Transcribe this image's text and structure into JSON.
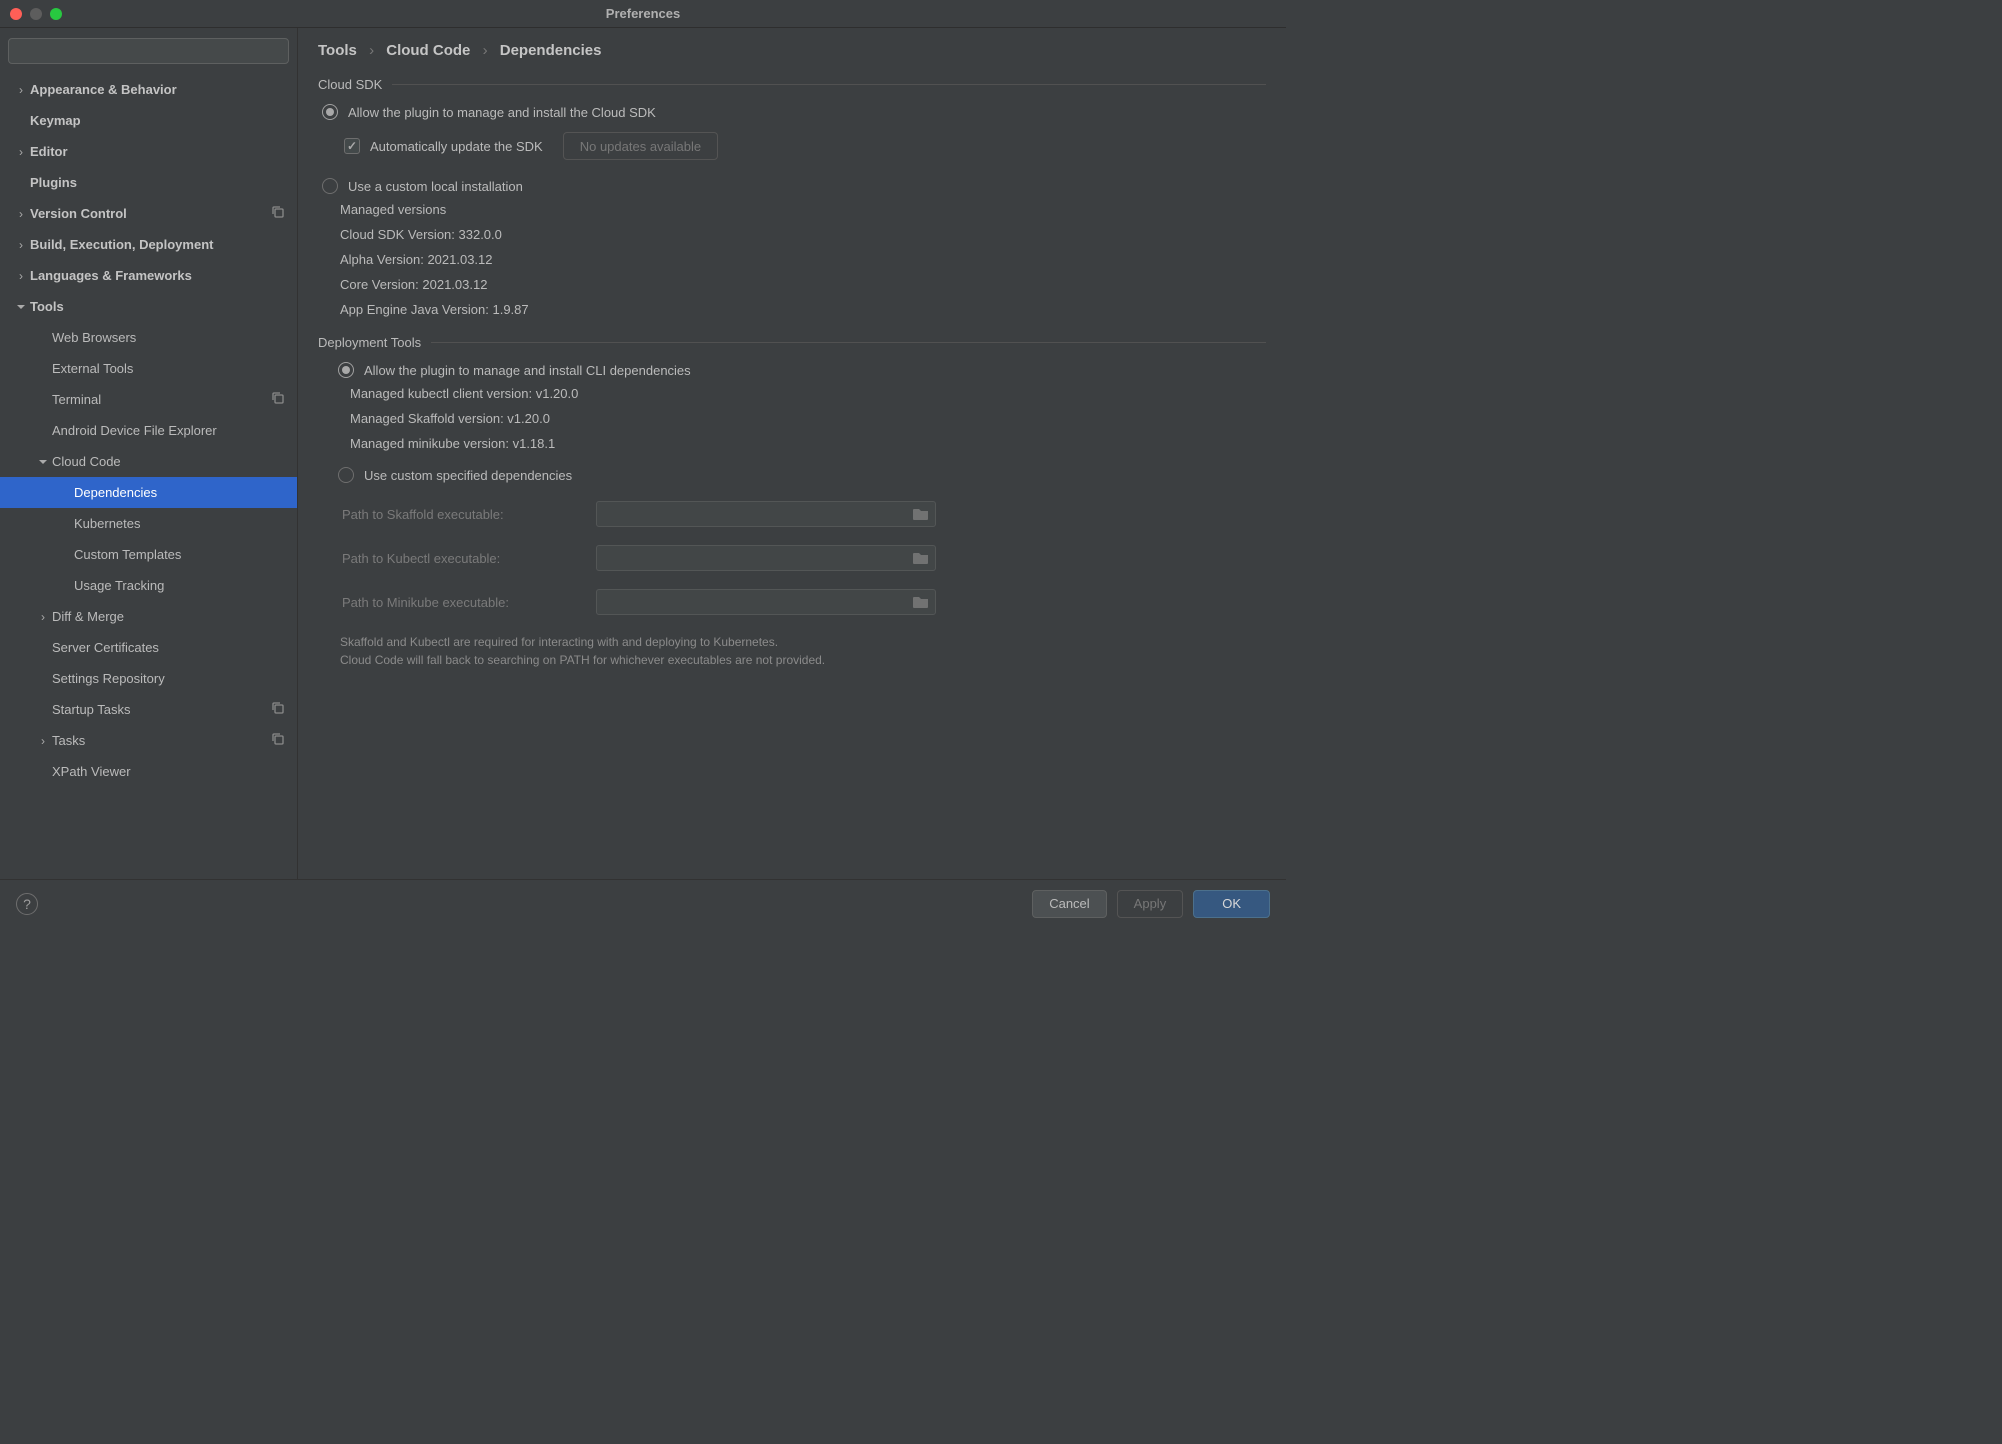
{
  "window": {
    "title": "Preferences"
  },
  "sidebar": {
    "search_placeholder": "",
    "items": [
      {
        "label": "Appearance & Behavior",
        "bold": true,
        "arrow": "right",
        "indent": 1
      },
      {
        "label": "Keymap",
        "bold": true,
        "arrow": "",
        "indent": 1
      },
      {
        "label": "Editor",
        "bold": true,
        "arrow": "right",
        "indent": 1
      },
      {
        "label": "Plugins",
        "bold": true,
        "arrow": "",
        "indent": 1
      },
      {
        "label": "Version Control",
        "bold": true,
        "arrow": "right",
        "indent": 1,
        "copy": true
      },
      {
        "label": "Build, Execution, Deployment",
        "bold": true,
        "arrow": "right",
        "indent": 1
      },
      {
        "label": "Languages & Frameworks",
        "bold": true,
        "arrow": "right",
        "indent": 1
      },
      {
        "label": "Tools",
        "bold": true,
        "arrow": "down",
        "indent": 1
      },
      {
        "label": "Web Browsers",
        "indent": 2,
        "arrow": ""
      },
      {
        "label": "External Tools",
        "indent": 2,
        "arrow": ""
      },
      {
        "label": "Terminal",
        "indent": 2,
        "arrow": "",
        "copy": true
      },
      {
        "label": "Android Device File Explorer",
        "indent": 2,
        "arrow": ""
      },
      {
        "label": "Cloud Code",
        "indent": 2,
        "arrow": "down"
      },
      {
        "label": "Dependencies",
        "indent": 3,
        "arrow": "",
        "selected": true
      },
      {
        "label": "Kubernetes",
        "indent": 3,
        "arrow": ""
      },
      {
        "label": "Custom Templates",
        "indent": 3,
        "arrow": ""
      },
      {
        "label": "Usage Tracking",
        "indent": 3,
        "arrow": ""
      },
      {
        "label": "Diff & Merge",
        "indent": 2,
        "arrow": "right"
      },
      {
        "label": "Server Certificates",
        "indent": 2,
        "arrow": ""
      },
      {
        "label": "Settings Repository",
        "indent": 2,
        "arrow": ""
      },
      {
        "label": "Startup Tasks",
        "indent": 2,
        "arrow": "",
        "copy": true
      },
      {
        "label": "Tasks",
        "indent": 2,
        "arrow": "right",
        "copy": true
      },
      {
        "label": "XPath Viewer",
        "indent": 2,
        "arrow": ""
      }
    ]
  },
  "breadcrumb": {
    "p0": "Tools",
    "p1": "Cloud Code",
    "p2": "Dependencies"
  },
  "cloud_sdk": {
    "header": "Cloud SDK",
    "opt_managed": "Allow the plugin to manage and install the Cloud SDK",
    "auto_update": "Automatically update the SDK",
    "no_updates_btn": "No updates available",
    "opt_custom": "Use a custom local installation",
    "managed_versions": "Managed versions",
    "sdk_version": "Cloud SDK Version: 332.0.0",
    "alpha_version": "Alpha Version: 2021.03.12",
    "core_version": "Core Version: 2021.03.12",
    "appengine_version": "App Engine Java Version: 1.9.87"
  },
  "deploy": {
    "header": "Deployment Tools",
    "opt_managed": "Allow the plugin to manage and install CLI dependencies",
    "kubectl": "Managed kubectl client version: v1.20.0",
    "skaffold": "Managed Skaffold version: v1.20.0",
    "minikube": "Managed minikube version: v1.18.1",
    "opt_custom": "Use custom specified dependencies",
    "path_skaffold": "Path to Skaffold executable:",
    "path_kubectl": "Path to Kubectl executable:",
    "path_minikube": "Path to Minikube executable:",
    "hint1": "Skaffold and Kubectl are required for interacting with and deploying to Kubernetes.",
    "hint2": "Cloud Code will fall back to searching on PATH for whichever executables are not provided."
  },
  "footer": {
    "cancel": "Cancel",
    "apply": "Apply",
    "ok": "OK"
  }
}
